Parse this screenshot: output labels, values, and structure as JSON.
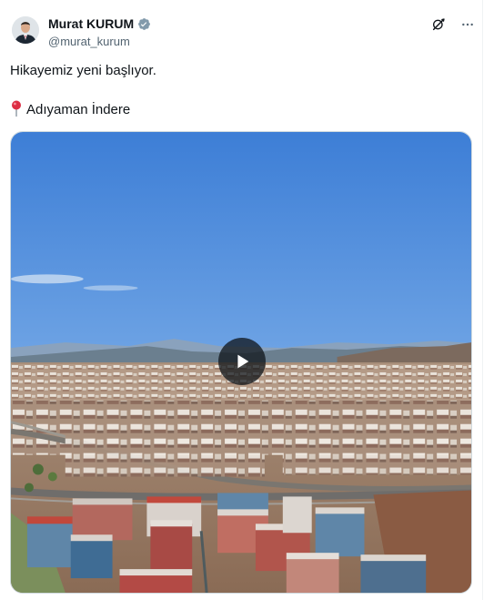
{
  "author": {
    "display_name": "Murat KURUM",
    "handle": "@murat_kurum",
    "verified": true,
    "avatar_icon": "profile-photo"
  },
  "header_actions": {
    "grok_icon": "grok-icon",
    "more_icon": "more-horizontal-icon"
  },
  "tweet": {
    "line1": "Hikayemiz yeni başlıyor.",
    "location_emoji": "round-pushpin",
    "line2": "Adıyaman İndere"
  },
  "media": {
    "type": "video",
    "play_icon": "play-icon"
  },
  "colors": {
    "text_primary": "#0f1419",
    "text_secondary": "#536471",
    "verified_badge": "#829aab",
    "border": "#cfd9de"
  }
}
